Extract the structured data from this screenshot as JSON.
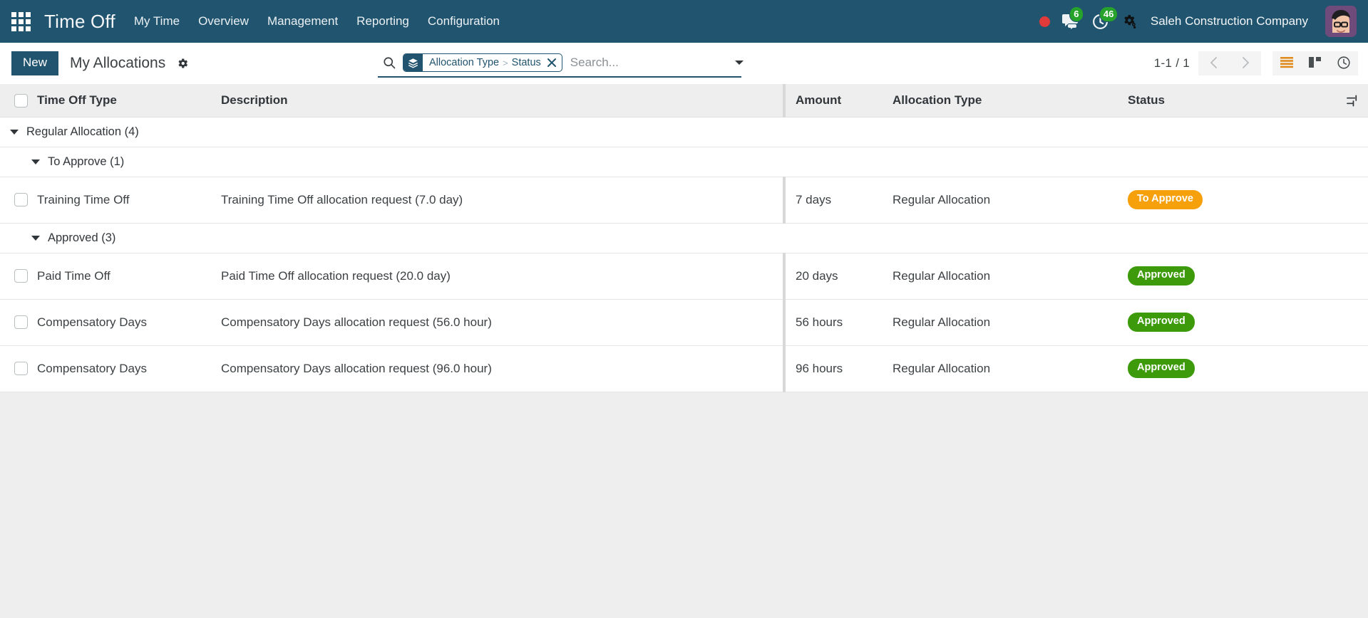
{
  "navbar": {
    "apps_icon": "apps-grid-icon",
    "brand": "Time Off",
    "menu": [
      {
        "label": "My Time"
      },
      {
        "label": "Overview"
      },
      {
        "label": "Management"
      },
      {
        "label": "Reporting"
      },
      {
        "label": "Configuration"
      }
    ],
    "recording_indicator": "record-dot",
    "messages_icon": "messages-icon",
    "messages_count": "6",
    "activities_icon": "activities-clock-icon",
    "activities_count": "46",
    "settings_icon": "gear-icon",
    "company": "Saleh Construction Company",
    "avatar": "user-avatar",
    "colors": {
      "navbar_bg": "#21546f",
      "badge_green": "#27a22b",
      "record_red": "#e03a3a"
    }
  },
  "control_panel": {
    "new_label": "New",
    "breadcrumb": "My Allocations",
    "gear_icon": "gear-icon",
    "search": {
      "magnifier_icon": "search-icon",
      "facet_icon": "group-by-layers-icon",
      "facet_values": [
        "Allocation Type",
        "Status"
      ],
      "facet_separator": ">",
      "facet_remove_icon": "close-icon",
      "placeholder": "Search...",
      "value": "",
      "dropdown_icon": "chevron-down-icon"
    },
    "pager": {
      "count": "1-1 / 1",
      "previous_icon": "chevron-left-icon",
      "next_icon": "chevron-right-icon"
    },
    "views": [
      {
        "name": "list",
        "icon": "list-view-icon",
        "active": true
      },
      {
        "name": "kanban",
        "icon": "kanban-view-icon",
        "active": false
      },
      {
        "name": "activity",
        "icon": "activity-clock-view-icon",
        "active": false
      }
    ]
  },
  "table": {
    "select_all_icon": "checkbox",
    "columns": [
      {
        "key": "type",
        "label": "Time Off Type"
      },
      {
        "key": "description",
        "label": "Description"
      },
      {
        "key": "amount",
        "label": "Amount"
      },
      {
        "key": "allocation_type",
        "label": "Allocation Type"
      },
      {
        "key": "status",
        "label": "Status"
      }
    ],
    "optional_columns_icon": "column-settings-icon",
    "groups": [
      {
        "level": 1,
        "label": "Regular Allocation (4)",
        "subgroups": [
          {
            "level": 2,
            "label": "To Approve (1)",
            "rows": [
              {
                "type": "Training Time Off",
                "description": "Training Time Off allocation request (7.0 day)",
                "amount": "7 days",
                "allocation_type": "Regular Allocation",
                "status": "To Approve",
                "status_style": "to-approve"
              }
            ]
          },
          {
            "level": 2,
            "label": "Approved (3)",
            "rows": [
              {
                "type": "Paid Time Off",
                "description": "Paid Time Off allocation request (20.0 day)",
                "amount": "20 days",
                "allocation_type": "Regular Allocation",
                "status": "Approved",
                "status_style": "approved"
              },
              {
                "type": "Compensatory Days",
                "description": "Compensatory Days allocation request (56.0 hour)",
                "amount": "56 hours",
                "allocation_type": "Regular Allocation",
                "status": "Approved",
                "status_style": "approved"
              },
              {
                "type": "Compensatory Days",
                "description": "Compensatory Days allocation request (96.0 hour)",
                "amount": "96 hours",
                "allocation_type": "Regular Allocation",
                "status": "Approved",
                "status_style": "approved"
              }
            ]
          }
        ]
      }
    ],
    "colors": {
      "badge_to_approve": "#f6a00c",
      "badge_approved": "#3c9a0b",
      "header_bg": "#eeeeee"
    }
  }
}
